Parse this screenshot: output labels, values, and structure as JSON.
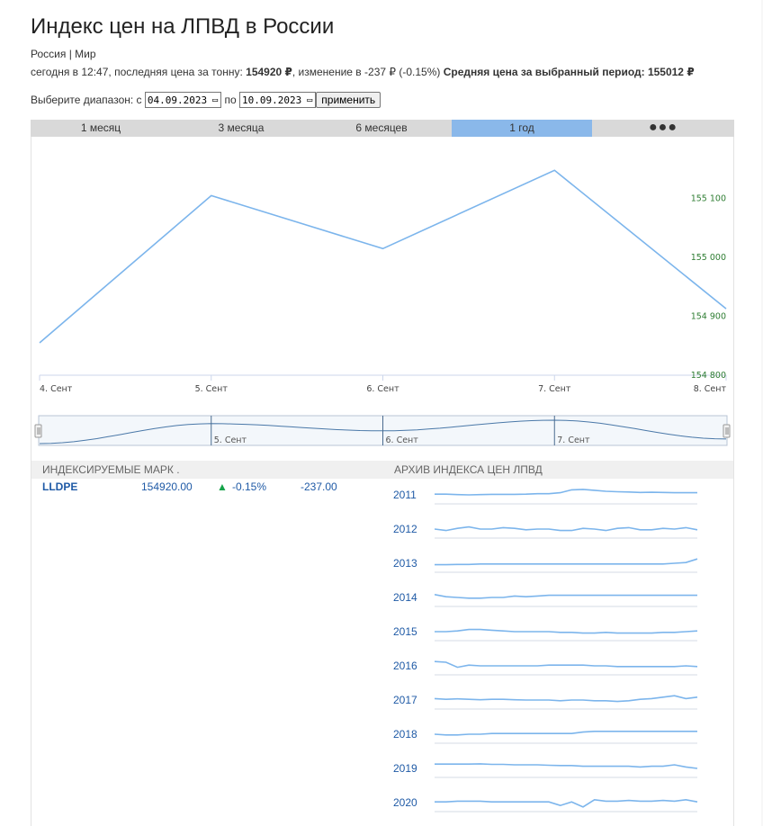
{
  "page": {
    "title": "Индекс цен на ЛПВД в России",
    "breadcrumb_1": "Россия",
    "breadcrumb_sep": "|",
    "breadcrumb_2": "Мир",
    "status_prefix": "сегодня в 12:47, последняя цена за тонну:",
    "last_price": "154920 ₽",
    "change_text": ", изменение в -237 ₽ (-0.15%)",
    "avg_label": "Средняя цена за выбранный период: 155012 ₽"
  },
  "range": {
    "label_from": "Выберите диапазон: с",
    "from_value": "04.09.2023",
    "label_to": "по",
    "to_value": "10.09.2023",
    "apply_label": "применить"
  },
  "tabs": [
    {
      "label": "1 месяц",
      "active": false
    },
    {
      "label": "3 месяца",
      "active": false
    },
    {
      "label": "6 месяцев",
      "active": false
    },
    {
      "label": "1 год",
      "active": true
    },
    {
      "label": "●●●",
      "active": false
    }
  ],
  "chart_data": {
    "type": "line",
    "x": [
      "4. Сент",
      "5. Сент",
      "6. Сент",
      "7. Сент",
      "8. Сент"
    ],
    "values": [
      154855,
      155105,
      155015,
      155148,
      154913
    ],
    "ytick_labels": [
      "155 100",
      "155 000",
      "154 900",
      "154 800"
    ],
    "yticks": [
      155100,
      155000,
      154900,
      154800
    ],
    "ylim": [
      154800,
      155150
    ],
    "navigator_labels": [
      "5. Сент",
      "6. Сент",
      "7. Сент"
    ],
    "line_color": "#7cb5ec",
    "ytick_color": "#2e7d32",
    "grid": false
  },
  "indexed": {
    "header": "ИНДЕКСИРУЕМЫЕ МАРК .",
    "rows": [
      {
        "name": "LLDPE",
        "price": "154920.00",
        "arrow": "▲",
        "pct": "-0.15%",
        "abs": "-237.00"
      }
    ]
  },
  "archive": {
    "header": "АРХИВ ИНДЕКСА ЦЕН ЛПВД",
    "years": [
      {
        "year": "2011",
        "values": [
          0.45,
          0.45,
          0.48,
          0.5,
          0.48,
          0.46,
          0.46,
          0.46,
          0.45,
          0.42,
          0.42,
          0.35,
          0.15,
          0.12,
          0.18,
          0.25,
          0.28,
          0.3,
          0.33,
          0.32,
          0.33,
          0.35,
          0.35,
          0.35
        ]
      },
      {
        "year": "2012",
        "values": [
          0.5,
          0.6,
          0.45,
          0.35,
          0.5,
          0.5,
          0.4,
          0.45,
          0.55,
          0.5,
          0.5,
          0.6,
          0.6,
          0.45,
          0.5,
          0.6,
          0.45,
          0.4,
          0.55,
          0.55,
          0.45,
          0.5,
          0.4,
          0.55
        ]
      },
      {
        "year": "2013",
        "values": [
          0.6,
          0.6,
          0.58,
          0.58,
          0.55,
          0.55,
          0.55,
          0.55,
          0.55,
          0.55,
          0.55,
          0.55,
          0.55,
          0.55,
          0.55,
          0.55,
          0.55,
          0.55,
          0.55,
          0.55,
          0.55,
          0.5,
          0.45,
          0.2
        ]
      },
      {
        "year": "2014",
        "values": [
          0.3,
          0.45,
          0.5,
          0.55,
          0.55,
          0.5,
          0.5,
          0.4,
          0.45,
          0.4,
          0.35,
          0.35,
          0.35,
          0.35,
          0.35,
          0.35,
          0.35,
          0.35,
          0.35,
          0.35,
          0.35,
          0.35,
          0.35,
          0.35
        ]
      },
      {
        "year": "2015",
        "values": [
          0.5,
          0.5,
          0.45,
          0.35,
          0.35,
          0.4,
          0.45,
          0.5,
          0.5,
          0.5,
          0.5,
          0.55,
          0.55,
          0.6,
          0.6,
          0.55,
          0.6,
          0.6,
          0.6,
          0.6,
          0.55,
          0.55,
          0.5,
          0.45
        ]
      },
      {
        "year": "2016",
        "values": [
          0.2,
          0.25,
          0.6,
          0.45,
          0.5,
          0.5,
          0.5,
          0.5,
          0.5,
          0.5,
          0.45,
          0.45,
          0.45,
          0.45,
          0.5,
          0.5,
          0.55,
          0.55,
          0.55,
          0.55,
          0.55,
          0.55,
          0.5,
          0.55
        ]
      },
      {
        "year": "2017",
        "values": [
          0.4,
          0.45,
          0.42,
          0.45,
          0.48,
          0.45,
          0.45,
          0.48,
          0.5,
          0.5,
          0.5,
          0.55,
          0.5,
          0.5,
          0.55,
          0.55,
          0.6,
          0.55,
          0.45,
          0.4,
          0.3,
          0.2,
          0.4,
          0.3
        ]
      },
      {
        "year": "2018",
        "values": [
          0.5,
          0.55,
          0.55,
          0.5,
          0.5,
          0.45,
          0.45,
          0.45,
          0.45,
          0.45,
          0.45,
          0.45,
          0.45,
          0.35,
          0.3,
          0.3,
          0.3,
          0.3,
          0.3,
          0.3,
          0.3,
          0.3,
          0.3,
          0.3
        ]
      },
      {
        "year": "2019",
        "values": [
          0.2,
          0.2,
          0.2,
          0.2,
          0.18,
          0.22,
          0.22,
          0.25,
          0.25,
          0.25,
          0.28,
          0.3,
          0.3,
          0.35,
          0.35,
          0.35,
          0.35,
          0.35,
          0.4,
          0.35,
          0.35,
          0.25,
          0.4,
          0.5
        ]
      },
      {
        "year": "2020",
        "values": [
          0.45,
          0.45,
          0.4,
          0.4,
          0.4,
          0.45,
          0.45,
          0.45,
          0.45,
          0.45,
          0.45,
          0.7,
          0.45,
          0.8,
          0.3,
          0.4,
          0.4,
          0.35,
          0.4,
          0.4,
          0.35,
          0.4,
          0.3,
          0.45
        ]
      }
    ]
  }
}
